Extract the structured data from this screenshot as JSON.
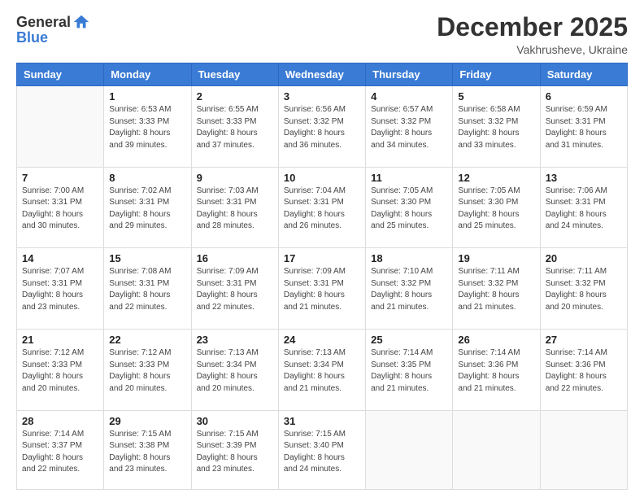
{
  "logo": {
    "general": "General",
    "blue": "Blue"
  },
  "header": {
    "month": "December 2025",
    "location": "Vakhrusheve, Ukraine"
  },
  "weekdays": [
    "Sunday",
    "Monday",
    "Tuesday",
    "Wednesday",
    "Thursday",
    "Friday",
    "Saturday"
  ],
  "weeks": [
    [
      {
        "day": "",
        "sunrise": "",
        "sunset": "",
        "daylight": ""
      },
      {
        "day": "1",
        "sunrise": "Sunrise: 6:53 AM",
        "sunset": "Sunset: 3:33 PM",
        "daylight": "Daylight: 8 hours and 39 minutes."
      },
      {
        "day": "2",
        "sunrise": "Sunrise: 6:55 AM",
        "sunset": "Sunset: 3:33 PM",
        "daylight": "Daylight: 8 hours and 37 minutes."
      },
      {
        "day": "3",
        "sunrise": "Sunrise: 6:56 AM",
        "sunset": "Sunset: 3:32 PM",
        "daylight": "Daylight: 8 hours and 36 minutes."
      },
      {
        "day": "4",
        "sunrise": "Sunrise: 6:57 AM",
        "sunset": "Sunset: 3:32 PM",
        "daylight": "Daylight: 8 hours and 34 minutes."
      },
      {
        "day": "5",
        "sunrise": "Sunrise: 6:58 AM",
        "sunset": "Sunset: 3:32 PM",
        "daylight": "Daylight: 8 hours and 33 minutes."
      },
      {
        "day": "6",
        "sunrise": "Sunrise: 6:59 AM",
        "sunset": "Sunset: 3:31 PM",
        "daylight": "Daylight: 8 hours and 31 minutes."
      }
    ],
    [
      {
        "day": "7",
        "sunrise": "Sunrise: 7:00 AM",
        "sunset": "Sunset: 3:31 PM",
        "daylight": "Daylight: 8 hours and 30 minutes."
      },
      {
        "day": "8",
        "sunrise": "Sunrise: 7:02 AM",
        "sunset": "Sunset: 3:31 PM",
        "daylight": "Daylight: 8 hours and 29 minutes."
      },
      {
        "day": "9",
        "sunrise": "Sunrise: 7:03 AM",
        "sunset": "Sunset: 3:31 PM",
        "daylight": "Daylight: 8 hours and 28 minutes."
      },
      {
        "day": "10",
        "sunrise": "Sunrise: 7:04 AM",
        "sunset": "Sunset: 3:31 PM",
        "daylight": "Daylight: 8 hours and 26 minutes."
      },
      {
        "day": "11",
        "sunrise": "Sunrise: 7:05 AM",
        "sunset": "Sunset: 3:30 PM",
        "daylight": "Daylight: 8 hours and 25 minutes."
      },
      {
        "day": "12",
        "sunrise": "Sunrise: 7:05 AM",
        "sunset": "Sunset: 3:30 PM",
        "daylight": "Daylight: 8 hours and 25 minutes."
      },
      {
        "day": "13",
        "sunrise": "Sunrise: 7:06 AM",
        "sunset": "Sunset: 3:31 PM",
        "daylight": "Daylight: 8 hours and 24 minutes."
      }
    ],
    [
      {
        "day": "14",
        "sunrise": "Sunrise: 7:07 AM",
        "sunset": "Sunset: 3:31 PM",
        "daylight": "Daylight: 8 hours and 23 minutes."
      },
      {
        "day": "15",
        "sunrise": "Sunrise: 7:08 AM",
        "sunset": "Sunset: 3:31 PM",
        "daylight": "Daylight: 8 hours and 22 minutes."
      },
      {
        "day": "16",
        "sunrise": "Sunrise: 7:09 AM",
        "sunset": "Sunset: 3:31 PM",
        "daylight": "Daylight: 8 hours and 22 minutes."
      },
      {
        "day": "17",
        "sunrise": "Sunrise: 7:09 AM",
        "sunset": "Sunset: 3:31 PM",
        "daylight": "Daylight: 8 hours and 21 minutes."
      },
      {
        "day": "18",
        "sunrise": "Sunrise: 7:10 AM",
        "sunset": "Sunset: 3:32 PM",
        "daylight": "Daylight: 8 hours and 21 minutes."
      },
      {
        "day": "19",
        "sunrise": "Sunrise: 7:11 AM",
        "sunset": "Sunset: 3:32 PM",
        "daylight": "Daylight: 8 hours and 21 minutes."
      },
      {
        "day": "20",
        "sunrise": "Sunrise: 7:11 AM",
        "sunset": "Sunset: 3:32 PM",
        "daylight": "Daylight: 8 hours and 20 minutes."
      }
    ],
    [
      {
        "day": "21",
        "sunrise": "Sunrise: 7:12 AM",
        "sunset": "Sunset: 3:33 PM",
        "daylight": "Daylight: 8 hours and 20 minutes."
      },
      {
        "day": "22",
        "sunrise": "Sunrise: 7:12 AM",
        "sunset": "Sunset: 3:33 PM",
        "daylight": "Daylight: 8 hours and 20 minutes."
      },
      {
        "day": "23",
        "sunrise": "Sunrise: 7:13 AM",
        "sunset": "Sunset: 3:34 PM",
        "daylight": "Daylight: 8 hours and 20 minutes."
      },
      {
        "day": "24",
        "sunrise": "Sunrise: 7:13 AM",
        "sunset": "Sunset: 3:34 PM",
        "daylight": "Daylight: 8 hours and 21 minutes."
      },
      {
        "day": "25",
        "sunrise": "Sunrise: 7:14 AM",
        "sunset": "Sunset: 3:35 PM",
        "daylight": "Daylight: 8 hours and 21 minutes."
      },
      {
        "day": "26",
        "sunrise": "Sunrise: 7:14 AM",
        "sunset": "Sunset: 3:36 PM",
        "daylight": "Daylight: 8 hours and 21 minutes."
      },
      {
        "day": "27",
        "sunrise": "Sunrise: 7:14 AM",
        "sunset": "Sunset: 3:36 PM",
        "daylight": "Daylight: 8 hours and 22 minutes."
      }
    ],
    [
      {
        "day": "28",
        "sunrise": "Sunrise: 7:14 AM",
        "sunset": "Sunset: 3:37 PM",
        "daylight": "Daylight: 8 hours and 22 minutes."
      },
      {
        "day": "29",
        "sunrise": "Sunrise: 7:15 AM",
        "sunset": "Sunset: 3:38 PM",
        "daylight": "Daylight: 8 hours and 23 minutes."
      },
      {
        "day": "30",
        "sunrise": "Sunrise: 7:15 AM",
        "sunset": "Sunset: 3:39 PM",
        "daylight": "Daylight: 8 hours and 23 minutes."
      },
      {
        "day": "31",
        "sunrise": "Sunrise: 7:15 AM",
        "sunset": "Sunset: 3:40 PM",
        "daylight": "Daylight: 8 hours and 24 minutes."
      },
      {
        "day": "",
        "sunrise": "",
        "sunset": "",
        "daylight": ""
      },
      {
        "day": "",
        "sunrise": "",
        "sunset": "",
        "daylight": ""
      },
      {
        "day": "",
        "sunrise": "",
        "sunset": "",
        "daylight": ""
      }
    ]
  ]
}
